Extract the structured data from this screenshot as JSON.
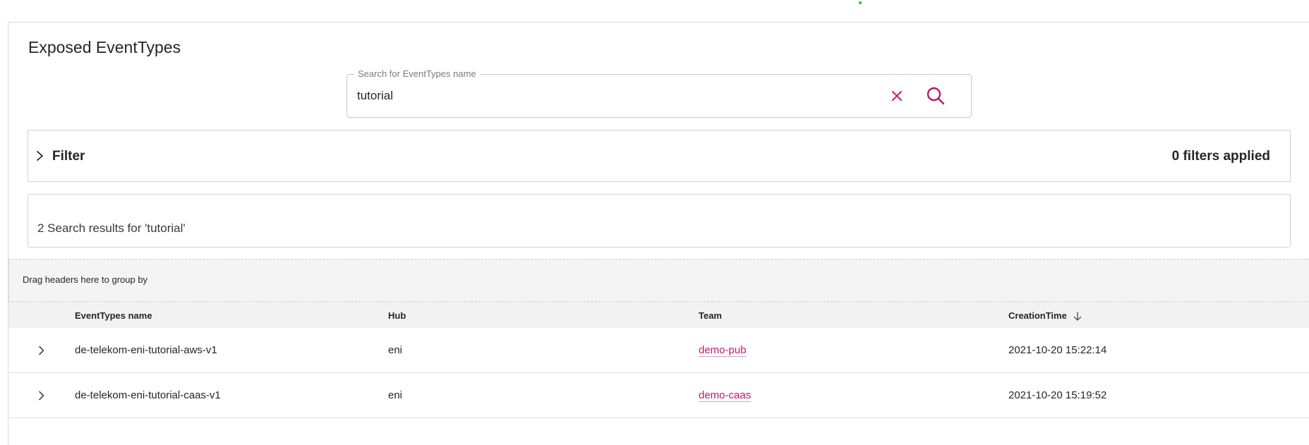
{
  "page": {
    "title": "Exposed EventTypes"
  },
  "search": {
    "legend": "Search for EventTypes name",
    "value": "tutorial",
    "clear_icon": "close-icon",
    "search_icon": "search-icon",
    "accent_color": "#c2176f"
  },
  "filter": {
    "label": "Filter",
    "applied": "0 filters applied",
    "chevron_icon": "chevron-right-icon"
  },
  "results": {
    "summary": "2 Search results for 'tutorial'"
  },
  "grid": {
    "group_panel_text": "Drag headers here to group by",
    "columns": [
      {
        "label": "EventTypes name"
      },
      {
        "label": "Hub"
      },
      {
        "label": "Team"
      },
      {
        "label": "CreationTime",
        "sort": "descending"
      }
    ],
    "rows": [
      {
        "name": "de-telekom-eni-tutorial-aws-v1",
        "hub": "eni",
        "team": "demo-pub",
        "creation_time": "2021-10-20 15:22:14"
      },
      {
        "name": "de-telekom-eni-tutorial-caas-v1",
        "hub": "eni",
        "team": "demo-caas",
        "creation_time": "2021-10-20 15:19:52"
      }
    ]
  }
}
